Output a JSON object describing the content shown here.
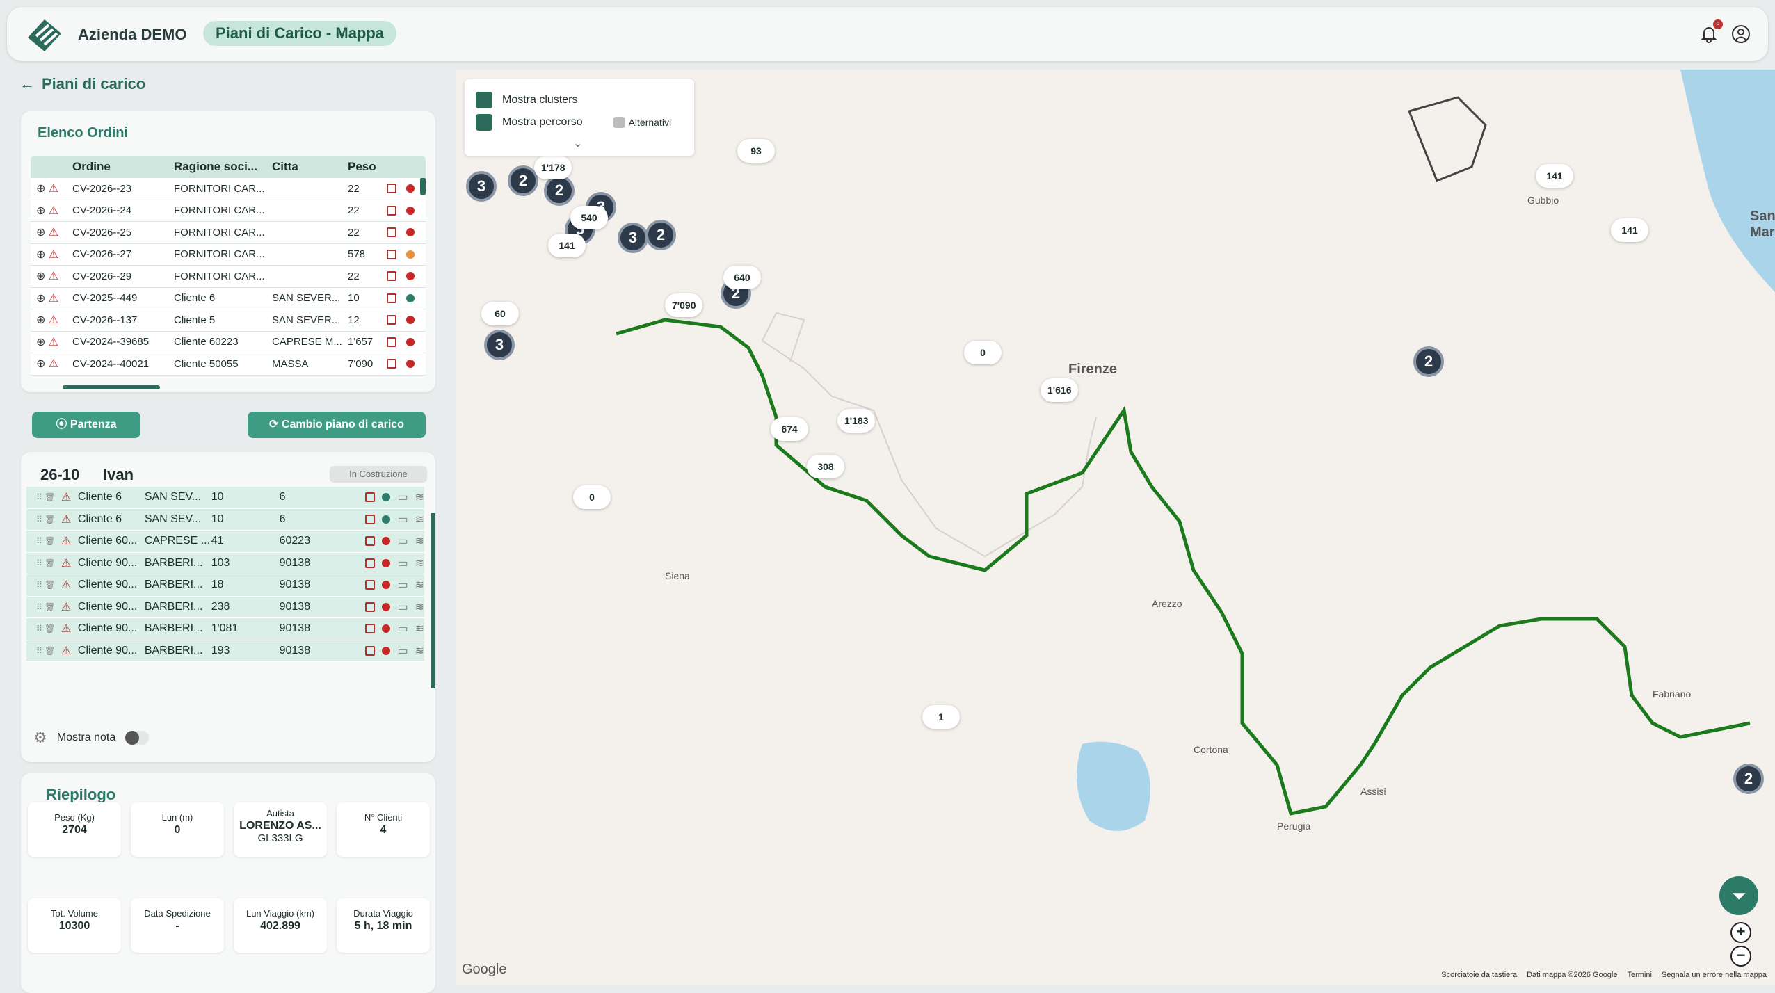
{
  "header": {
    "company": "Azienda DEMO",
    "page_pill": "Piani di Carico - Mappa",
    "notifications": "9"
  },
  "nav": {
    "back_label": "Piani di carico"
  },
  "orders": {
    "title": "Elenco Ordini",
    "columns": [
      "Ordine",
      "Ragione soci...",
      "Citta",
      "Peso"
    ],
    "rows": [
      {
        "ordine": "CV-2026--23",
        "ragione": "FORNITORI CAR...",
        "citta": "",
        "peso": "22",
        "dot": "#c62828"
      },
      {
        "ordine": "CV-2026--24",
        "ragione": "FORNITORI CAR...",
        "citta": "",
        "peso": "22",
        "dot": "#c62828"
      },
      {
        "ordine": "CV-2026--25",
        "ragione": "FORNITORI CAR...",
        "citta": "",
        "peso": "22",
        "dot": "#c62828"
      },
      {
        "ordine": "CV-2026--27",
        "ragione": "FORNITORI CAR...",
        "citta": "",
        "peso": "578",
        "dot": "#e8903c"
      },
      {
        "ordine": "CV-2026--29",
        "ragione": "FORNITORI CAR...",
        "citta": "",
        "peso": "22",
        "dot": "#c62828"
      },
      {
        "ordine": "CV-2025--449",
        "ragione": "Cliente 6",
        "citta": "SAN SEVER...",
        "peso": "10",
        "dot": "#2e7d6b"
      },
      {
        "ordine": "CV-2026--137",
        "ragione": "Cliente 5",
        "citta": "SAN SEVER...",
        "peso": "12",
        "dot": "#c62828"
      },
      {
        "ordine": "CV-2024--39685",
        "ragione": "Cliente 60223",
        "citta": "CAPRESE M...",
        "peso": "1'657",
        "dot": "#c62828"
      },
      {
        "ordine": "CV-2024--40021",
        "ragione": "Cliente 50055",
        "citta": "MASSA",
        "peso": "7'090",
        "dot": "#c62828"
      }
    ]
  },
  "actions": {
    "partenza": "Partenza",
    "cambio": "Cambio piano di carico"
  },
  "plan": {
    "code": "26-10",
    "driver": "Ivan",
    "status": "In Costruzione",
    "rows": [
      {
        "cliente": "Cliente 6",
        "citta": "SAN SEV...",
        "qta": "10",
        "zona": "6",
        "dot": "#2e7d6b"
      },
      {
        "cliente": "Cliente 6",
        "citta": "SAN SEV...",
        "qta": "10",
        "zona": "6",
        "dot": "#2e7d6b"
      },
      {
        "cliente": "Cliente 60...",
        "citta": "CAPRESE ...",
        "qta": "41",
        "zona": "60223",
        "dot": "#c62828"
      },
      {
        "cliente": "Cliente 90...",
        "citta": "BARBERI...",
        "qta": "103",
        "zona": "90138",
        "dot": "#c62828"
      },
      {
        "cliente": "Cliente 90...",
        "citta": "BARBERI...",
        "qta": "18",
        "zona": "90138",
        "dot": "#c62828"
      },
      {
        "cliente": "Cliente 90...",
        "citta": "BARBERI...",
        "qta": "238",
        "zona": "90138",
        "dot": "#c62828"
      },
      {
        "cliente": "Cliente 90...",
        "citta": "BARBERI...",
        "qta": "1'081",
        "zona": "90138",
        "dot": "#c62828"
      },
      {
        "cliente": "Cliente 90...",
        "citta": "BARBERI...",
        "qta": "193",
        "zona": "90138",
        "dot": "#c62828"
      }
    ],
    "nota_label": "Mostra nota"
  },
  "summary": {
    "title": "Riepilogo",
    "peso": {
      "label": "Peso (Kg)",
      "value": "2704"
    },
    "lun": {
      "label": "Lun (m)",
      "value": "0"
    },
    "autista": {
      "label": "Autista",
      "value": "LORENZO AS...",
      "sub": "GL333LG"
    },
    "clienti": {
      "label": "N° Clienti",
      "value": "4"
    },
    "volume": {
      "label": "Tot. Volume",
      "value": "10300"
    },
    "spedizione": {
      "label": "Data Spedizione",
      "value": "-"
    },
    "viaggio": {
      "label": "Lun Viaggio (km)",
      "value": "402.899"
    },
    "durata": {
      "label": "Durata Viaggio",
      "value": "5 h, 18 min"
    }
  },
  "map": {
    "legend": {
      "clusters": "Mostra clusters",
      "percorso": "Mostra percorso",
      "alternativi": "Alternativi"
    },
    "places": [
      {
        "name": "Firenze",
        "big": true
      },
      {
        "name": "San Marino",
        "big": true
      },
      {
        "name": "Perugia",
        "big": false
      },
      {
        "name": "Arezzo",
        "big": false
      },
      {
        "name": "Cortona",
        "big": false
      },
      {
        "name": "Gubbio",
        "big": false
      },
      {
        "name": "Siena",
        "big": false
      },
      {
        "name": "Fabriano",
        "big": false
      },
      {
        "name": "Assisi",
        "big": false
      }
    ],
    "clusters": [
      "3",
      "2",
      "2",
      "3",
      "5",
      "3",
      "2",
      "2",
      "3",
      "2",
      "2"
    ],
    "labels": [
      "93",
      "1'178",
      "540",
      "141",
      "7'090",
      "60",
      "640",
      "0",
      "1'616",
      "674",
      "1'183",
      "308",
      "0",
      "1",
      "141",
      "141"
    ],
    "google": "Google",
    "attribution": [
      "Scorciatoie da tastiera",
      "Dati mappa ©2026 Google",
      "Termini",
      "Segnala un errore nella mappa"
    ],
    "colors": {
      "route": "#1b7a1b",
      "cluster": "#2d3a4a",
      "water": "#a9d4ea"
    }
  }
}
